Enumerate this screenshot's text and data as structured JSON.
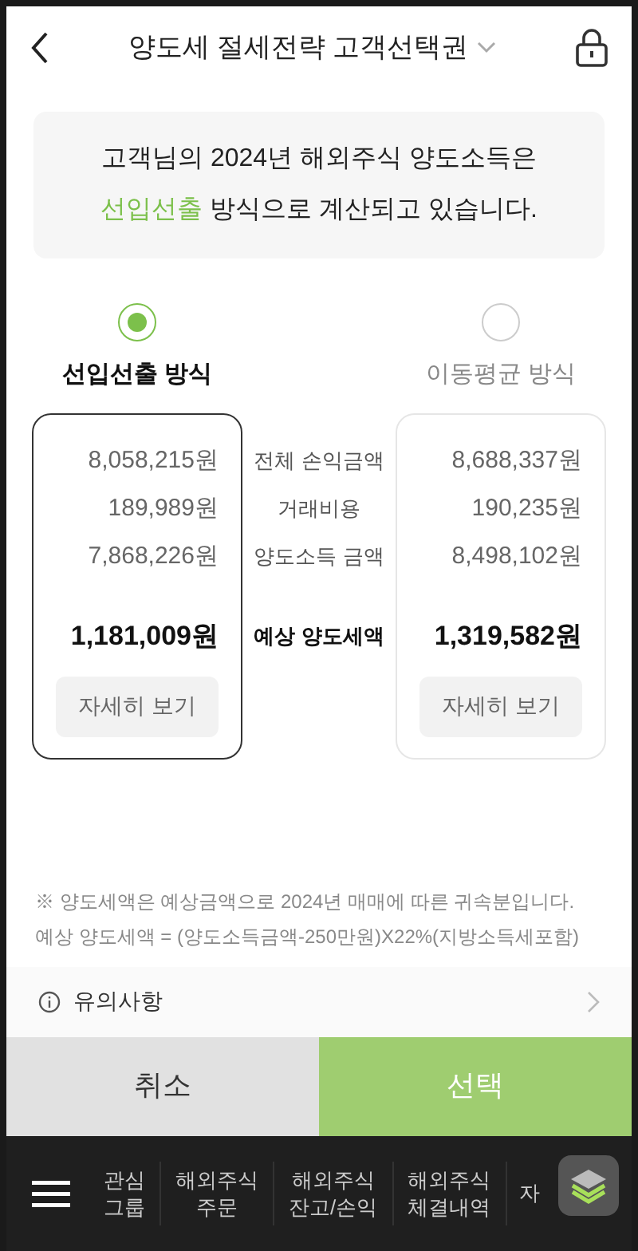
{
  "header": {
    "title": "양도세 절세전략 고객선택권"
  },
  "notice": {
    "line1": "고객님의 2024년 해외주식 양도소득은",
    "highlight": "선입선출",
    "line2": "방식으로 계산되고 있습니다."
  },
  "methods": [
    {
      "label": "선입선출 방식",
      "selected": true,
      "values": [
        "8,058,215원",
        "189,989원",
        "7,868,226원"
      ],
      "tax": "1,181,009원",
      "button": "자세히 보기"
    },
    {
      "label": "이동평균 방식",
      "selected": false,
      "values": [
        "8,688,337원",
        "190,235원",
        "8,498,102원"
      ],
      "tax": "1,319,582원",
      "button": "자세히 보기"
    }
  ],
  "row_labels": [
    "전체 손익금액",
    "거래비용",
    "양도소득 금액"
  ],
  "tax_label": "예상 양도세액",
  "notes": [
    "※ 양도세액은 예상금액으로 2024년 매매에 따른 귀속분입니다.",
    "예상 양도세액 = (양도소득금액-250만원)X22%(지방소득세포함)"
  ],
  "caution": {
    "label": "유의사항"
  },
  "actions": {
    "cancel": "취소",
    "confirm": {
      "label": "선택",
      "disabled": true
    }
  },
  "nav": {
    "items": [
      {
        "lines": [
          "관심",
          "그룹"
        ]
      },
      {
        "lines": [
          "해외주식",
          "주문"
        ]
      },
      {
        "lines": [
          "해외주식",
          "잔고/손익"
        ]
      },
      {
        "lines": [
          "해외주식",
          "체결내역"
        ]
      },
      {
        "lines": [
          "자"
        ]
      }
    ]
  }
}
